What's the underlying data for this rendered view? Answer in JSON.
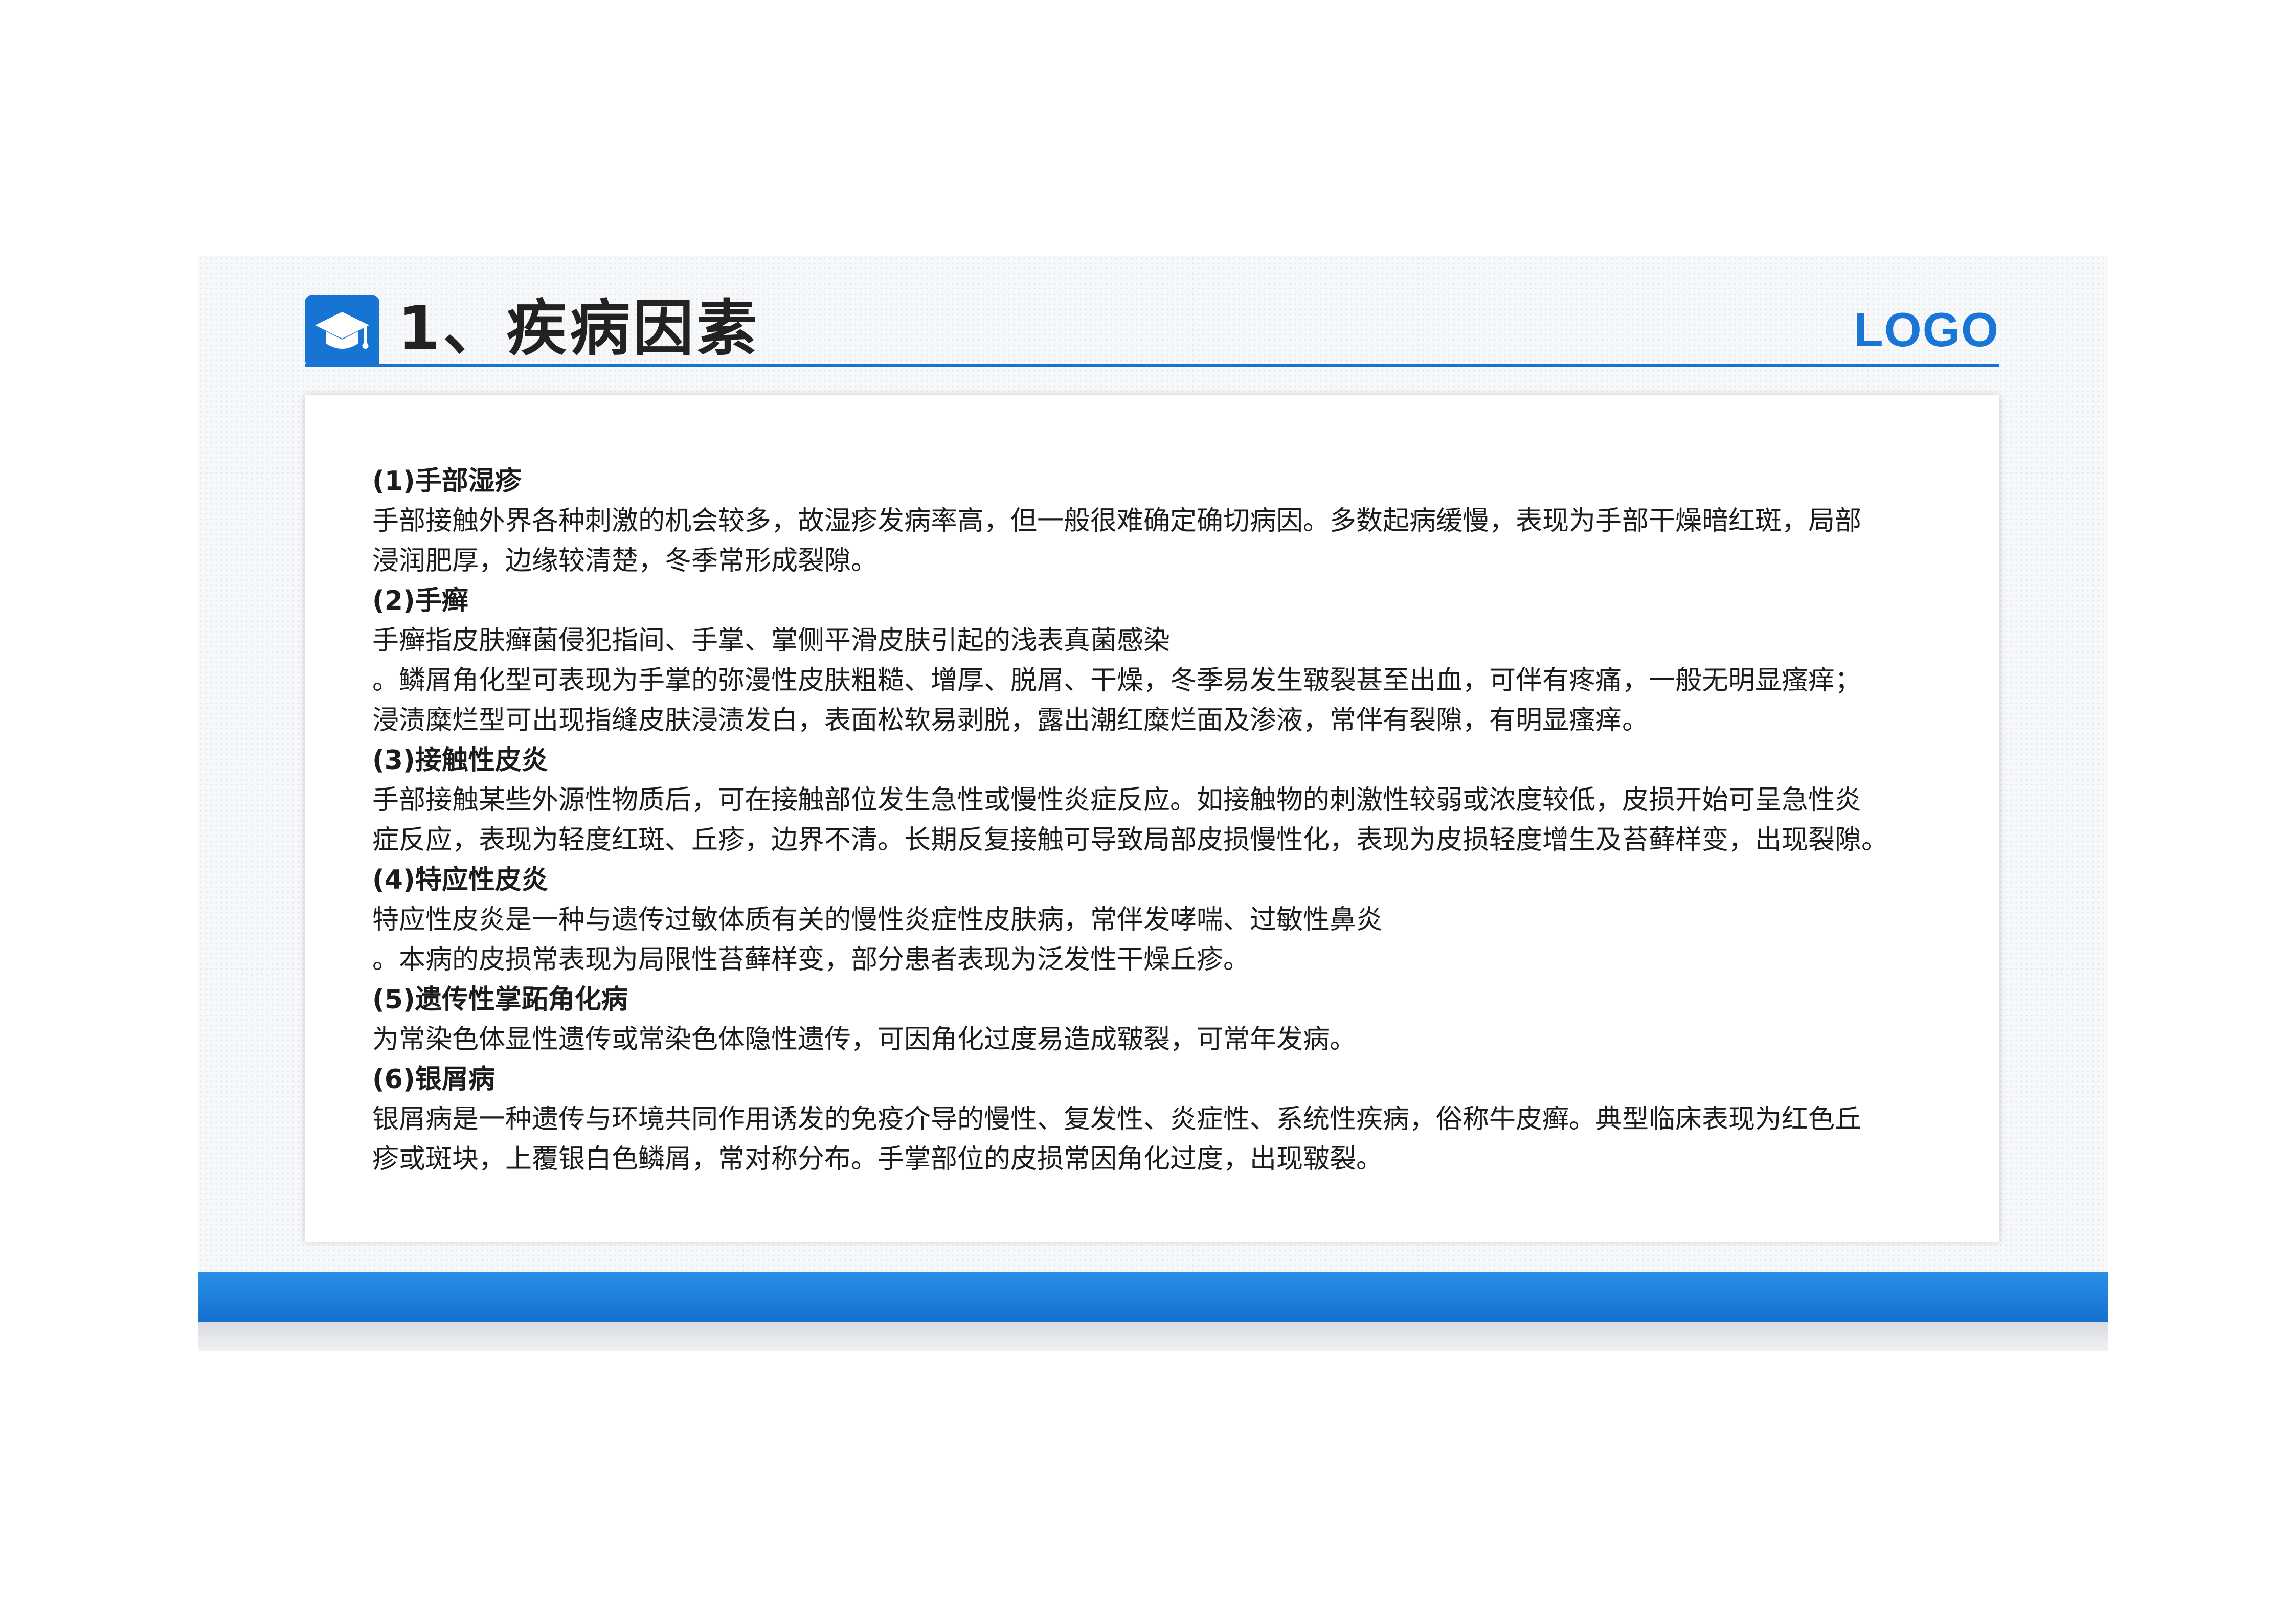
{
  "header": {
    "title": "1、疾病因素",
    "logo": "LOGO",
    "icon": "graduation-cap-icon",
    "accent_color": "#1874d2"
  },
  "items": [
    {
      "heading": "(1)手部湿疹",
      "lines": [
        "手部接触外界各种刺激的机会较多，故湿疹发病率高，但一般很难确定确切病因。多数起病缓慢，表现为手部干燥暗红斑，局部",
        "浸润肥厚，边缘较清楚，冬季常形成裂隙。"
      ]
    },
    {
      "heading": "(2)手癣",
      "lines": [
        "手癣指皮肤癣菌侵犯指间、手掌、掌侧平滑皮肤引起的浅表真菌感染",
        "。鳞屑角化型可表现为手掌的弥漫性皮肤粗糙、增厚、脱屑、干燥，冬季易发生皲裂甚至出血，可伴有疼痛，一般无明显瘙痒；",
        "浸渍糜烂型可出现指缝皮肤浸渍发白，表面松软易剥脱，露出潮红糜烂面及渗液，常伴有裂隙，有明显瘙痒。"
      ]
    },
    {
      "heading": "(3)接触性皮炎",
      "lines": [
        "手部接触某些外源性物质后，可在接触部位发生急性或慢性炎症反应。如接触物的刺激性较弱或浓度较低，皮损开始可呈急性炎",
        "症反应，表现为轻度红斑、丘疹，边界不清。长期反复接触可导致局部皮损慢性化，表现为皮损轻度增生及苔藓样变，出现裂隙。"
      ]
    },
    {
      "heading": "(4)特应性皮炎",
      "lines": [
        "特应性皮炎是一种与遗传过敏体质有关的慢性炎症性皮肤病，常伴发哮喘、过敏性鼻炎",
        "。本病的皮损常表现为局限性苔藓样变，部分患者表现为泛发性干燥丘疹。"
      ]
    },
    {
      "heading": "(5)遗传性掌跖角化病",
      "lines": [
        "为常染色体显性遗传或常染色体隐性遗传，可因角化过度易造成皲裂，可常年发病。"
      ]
    },
    {
      "heading": "(6)银屑病",
      "lines": [
        "银屑病是一种遗传与环境共同作用诱发的免疫介导的慢性、复发性、炎症性、系统性疾病，俗称牛皮癣。典型临床表现为红色丘",
        "疹或斑块，上覆银白色鳞屑，常对称分布。手掌部位的皮损常因角化过度，出现皲裂。"
      ]
    }
  ]
}
